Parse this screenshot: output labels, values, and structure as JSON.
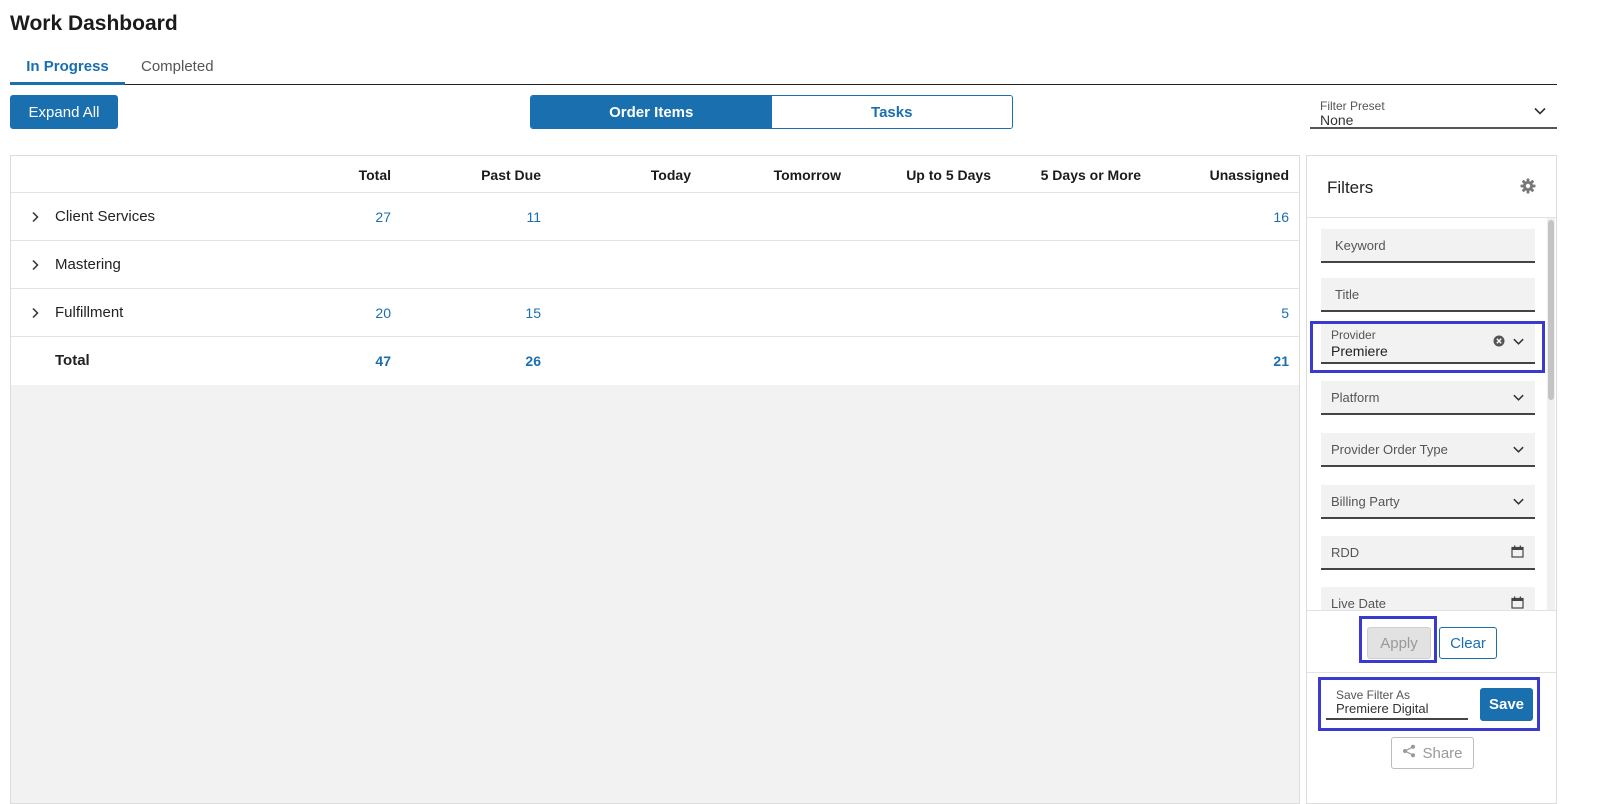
{
  "page": {
    "title": "Work Dashboard"
  },
  "tabs": {
    "active": "In Progress",
    "inactive": "Completed"
  },
  "toolbar": {
    "expand_all": "Expand All",
    "segment": {
      "order_items": "Order Items",
      "tasks": "Tasks",
      "selected": "Order Items"
    },
    "filter_preset": {
      "label": "Filter Preset",
      "value": "None"
    }
  },
  "table": {
    "headers": [
      "Total",
      "Past Due",
      "Today",
      "Tomorrow",
      "Up to 5 Days",
      "5 Days or More",
      "Unassigned"
    ],
    "rows": [
      {
        "name": "Client Services",
        "total": "27",
        "past_due": "11",
        "unassigned": "16"
      },
      {
        "name": "Mastering",
        "total": "",
        "past_due": "",
        "unassigned": ""
      },
      {
        "name": "Fulfillment",
        "total": "20",
        "past_due": "15",
        "unassigned": "5"
      }
    ],
    "totals": {
      "name": "Total",
      "total": "47",
      "past_due": "26",
      "unassigned": "21"
    }
  },
  "filters": {
    "title": "Filters",
    "keyword_placeholder": "Keyword",
    "title_placeholder": "Title",
    "provider": {
      "label": "Provider",
      "value": "Premiere"
    },
    "platform_placeholder": "Platform",
    "provider_order_type_placeholder": "Provider Order Type",
    "billing_party_placeholder": "Billing Party",
    "rdd_placeholder": "RDD",
    "live_date_placeholder": "Live Date",
    "apply_label": "Apply",
    "clear_label": "Clear",
    "save_filter": {
      "label": "Save Filter As",
      "value": "Premiere Digital"
    },
    "save_label": "Save",
    "share_label": "Share"
  },
  "colors": {
    "accent": "#1a6fae",
    "highlight": "#3a3ad0",
    "panel_bg": "#f2f2f2"
  }
}
